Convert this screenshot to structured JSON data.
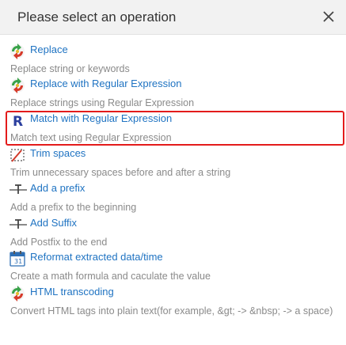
{
  "dialog": {
    "title": "Please select an operation",
    "close_icon": "close-icon"
  },
  "operations": [
    {
      "title": "Replace",
      "description": "Replace string or keywords",
      "icon": "recycle-icon"
    },
    {
      "title": "Replace with Regular Expression",
      "description": "Replace strings using Regular Expression",
      "icon": "recycle-icon"
    },
    {
      "title": "Match with Regular Expression",
      "description": "Match text using Regular Expression",
      "icon": "regex-r-icon",
      "highlighted": true
    },
    {
      "title": "Trim spaces",
      "description": "Trim unnecessary spaces before and after a string",
      "icon": "trim-icon"
    },
    {
      "title": "Add a prefix",
      "description": "Add a prefix to the beginning",
      "icon": "text-insert-icon"
    },
    {
      "title": "Add Suffix",
      "description": "Add Postfix to the end",
      "icon": "text-insert-icon"
    },
    {
      "title": "Reformat extracted data/time",
      "description": "Create a math formula and caculate the value",
      "icon": "calendar-icon"
    },
    {
      "title": "HTML transcoding",
      "description": "Convert HTML tags into plain text(for example, &gt; -> &nbsp; -> a space)",
      "icon": "recycle-icon"
    }
  ],
  "colors": {
    "link": "#1f73c2",
    "description": "#8a8a8a",
    "highlight_border": "#e31b1b",
    "header_bg": "#f2f2f2"
  }
}
